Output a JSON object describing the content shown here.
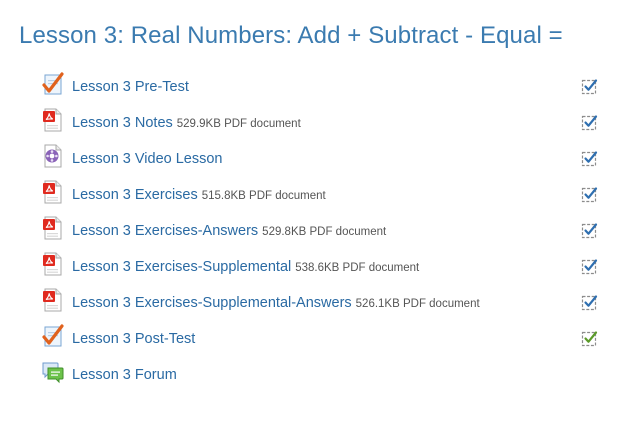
{
  "section": {
    "title": "Lesson 3: Real Numbers: Add + Subtract - Equal ="
  },
  "activities": [
    {
      "name": "Lesson 3 Pre-Test",
      "meta": "",
      "icon": "quiz-icon",
      "completion": "manual-done"
    },
    {
      "name": "Lesson 3 Notes",
      "meta": "529.9KB PDF document",
      "icon": "pdf-icon",
      "completion": "manual-done"
    },
    {
      "name": "Lesson 3 Video Lesson",
      "meta": "",
      "icon": "video-icon",
      "completion": "manual-done"
    },
    {
      "name": "Lesson 3 Exercises",
      "meta": "515.8KB PDF document",
      "icon": "pdf-icon",
      "completion": "manual-done"
    },
    {
      "name": "Lesson 3 Exercises-Answers",
      "meta": "529.8KB PDF document",
      "icon": "pdf-icon",
      "completion": "manual-done"
    },
    {
      "name": "Lesson 3 Exercises-Supplemental",
      "meta": "538.6KB PDF document",
      "icon": "pdf-icon",
      "completion": "manual-done"
    },
    {
      "name": "Lesson 3 Exercises-Supplemental-Answers",
      "meta": "526.1KB PDF document",
      "icon": "pdf-icon",
      "completion": "manual-done"
    },
    {
      "name": "Lesson 3 Post-Test",
      "meta": "",
      "icon": "quiz-icon",
      "completion": "auto-pass"
    },
    {
      "name": "Lesson 3 Forum",
      "meta": "",
      "icon": "forum-icon",
      "completion": "none"
    }
  ],
  "colors": {
    "title": "#3b7bb0",
    "link": "#2a6aa3",
    "meta": "#555555",
    "check_manual": "#2f6fb0",
    "check_pass": "#5b9a2a"
  }
}
